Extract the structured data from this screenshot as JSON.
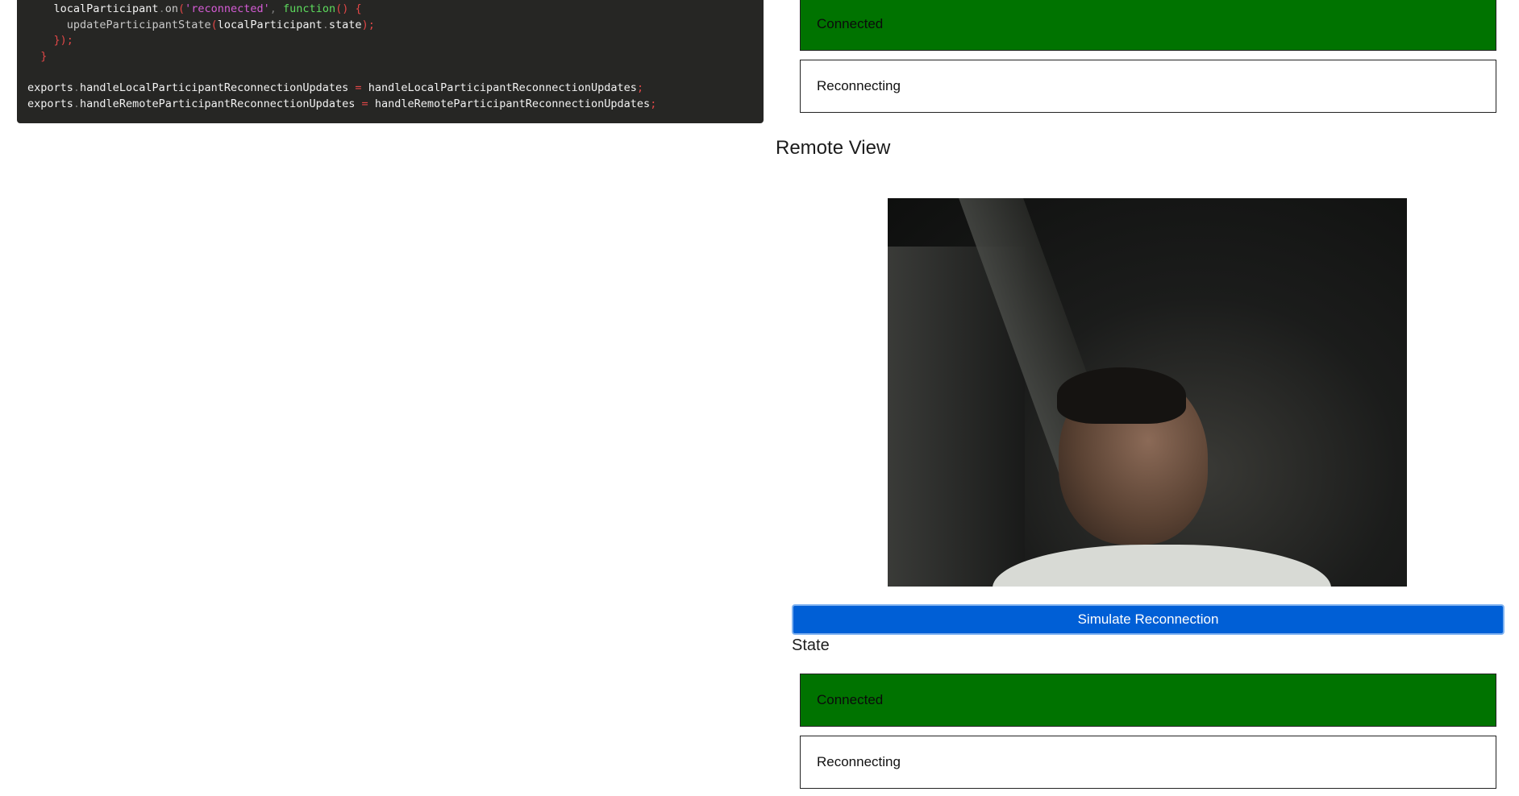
{
  "code": {
    "lines": [
      [
        {
          "t": "    ",
          "c": ""
        },
        {
          "t": "localParticipant",
          "c": "c-id"
        },
        {
          "t": ".",
          "c": "c-punc"
        },
        {
          "t": "on",
          "c": "c-dim"
        },
        {
          "t": "(",
          "c": "c-brace"
        },
        {
          "t": "'reconnected'",
          "c": "c-str"
        },
        {
          "t": ", ",
          "c": "c-punc"
        },
        {
          "t": "function",
          "c": "c-kw"
        },
        {
          "t": "() {",
          "c": "c-brace"
        }
      ],
      [
        {
          "t": "      ",
          "c": ""
        },
        {
          "t": "updateParticipantState",
          "c": "c-dim"
        },
        {
          "t": "(",
          "c": "c-brace"
        },
        {
          "t": "localParticipant",
          "c": "c-id"
        },
        {
          "t": ".",
          "c": "c-punc"
        },
        {
          "t": "state",
          "c": "c-id"
        },
        {
          "t": ");",
          "c": "c-brace"
        }
      ],
      [
        {
          "t": "    ",
          "c": ""
        },
        {
          "t": "});",
          "c": "c-brace"
        }
      ],
      [
        {
          "t": "  ",
          "c": ""
        },
        {
          "t": "}",
          "c": "c-brace"
        }
      ],
      [],
      [
        {
          "t": "exports",
          "c": "c-id"
        },
        {
          "t": ".",
          "c": "c-punc"
        },
        {
          "t": "handleLocalParticipantReconnectionUpdates",
          "c": "c-id"
        },
        {
          "t": " = ",
          "c": "c-brace"
        },
        {
          "t": "handleLocalParticipantReconnectionUpdates",
          "c": "c-id"
        },
        {
          "t": ";",
          "c": "c-brace"
        }
      ],
      [
        {
          "t": "exports",
          "c": "c-id"
        },
        {
          "t": ".",
          "c": "c-punc"
        },
        {
          "t": "handleRemoteParticipantReconnectionUpdates",
          "c": "c-id"
        },
        {
          "t": " = ",
          "c": "c-brace"
        },
        {
          "t": "handleRemoteParticipantReconnectionUpdates",
          "c": "c-id"
        },
        {
          "t": ";",
          "c": "c-brace"
        }
      ]
    ]
  },
  "local_states": {
    "connected": "Connected",
    "reconnecting": "Reconnecting"
  },
  "remote": {
    "heading": "Remote View",
    "button_label": "Simulate Reconnection",
    "state_label": "State",
    "connected": "Connected",
    "reconnecting": "Reconnecting"
  },
  "colors": {
    "active_state": "#007300",
    "button": "#005fd6",
    "code_bg": "#262624"
  }
}
